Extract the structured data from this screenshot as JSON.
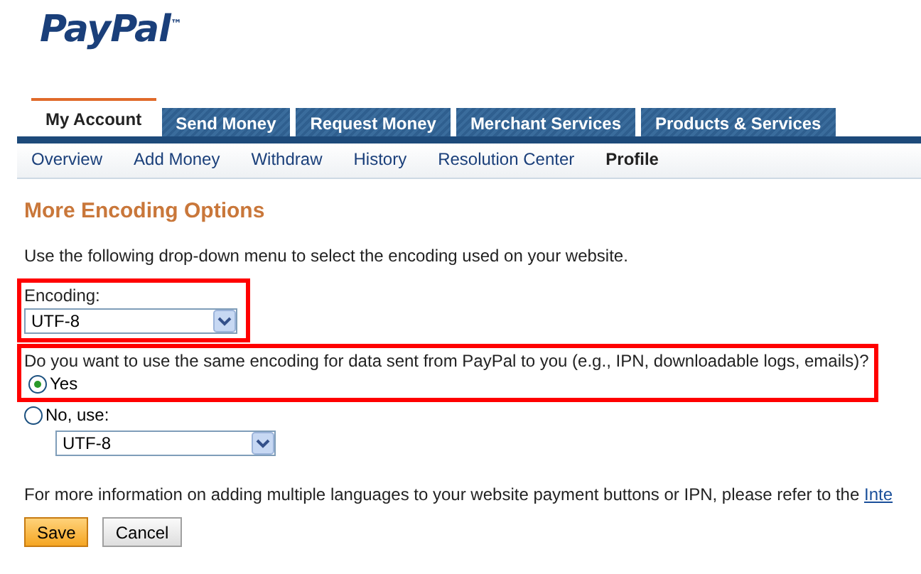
{
  "logo": {
    "text": "PayPal",
    "trademark": "™"
  },
  "tabs": [
    {
      "label": "My Account",
      "selected": true
    },
    {
      "label": "Send Money",
      "selected": false
    },
    {
      "label": "Request Money",
      "selected": false
    },
    {
      "label": "Merchant Services",
      "selected": false
    },
    {
      "label": "Products & Services",
      "selected": false
    }
  ],
  "subnav": [
    {
      "label": "Overview",
      "selected": false
    },
    {
      "label": "Add Money",
      "selected": false
    },
    {
      "label": "Withdraw",
      "selected": false
    },
    {
      "label": "History",
      "selected": false
    },
    {
      "label": "Resolution Center",
      "selected": false
    },
    {
      "label": "Profile",
      "selected": true
    }
  ],
  "heading": "More Encoding Options",
  "intro": "Use the following drop-down menu to select the encoding used on your website.",
  "encoding": {
    "label": "Encoding:",
    "value": "UTF-8"
  },
  "question": "Do you want to use the same encoding for data sent from PayPal to you (e.g., IPN, downloadable logs, emails)?",
  "options": [
    {
      "label": "Yes",
      "selected": true
    },
    {
      "label": "No, use:",
      "selected": false
    }
  ],
  "other_encoding": {
    "value": "UTF-8"
  },
  "info": {
    "text": "For more information on adding multiple languages to your website payment buttons or IPN, please refer to the",
    "link": "Inte"
  },
  "buttons": [
    {
      "label": "Save",
      "kind": "primary"
    },
    {
      "label": "Cancel",
      "kind": "secondary"
    }
  ]
}
